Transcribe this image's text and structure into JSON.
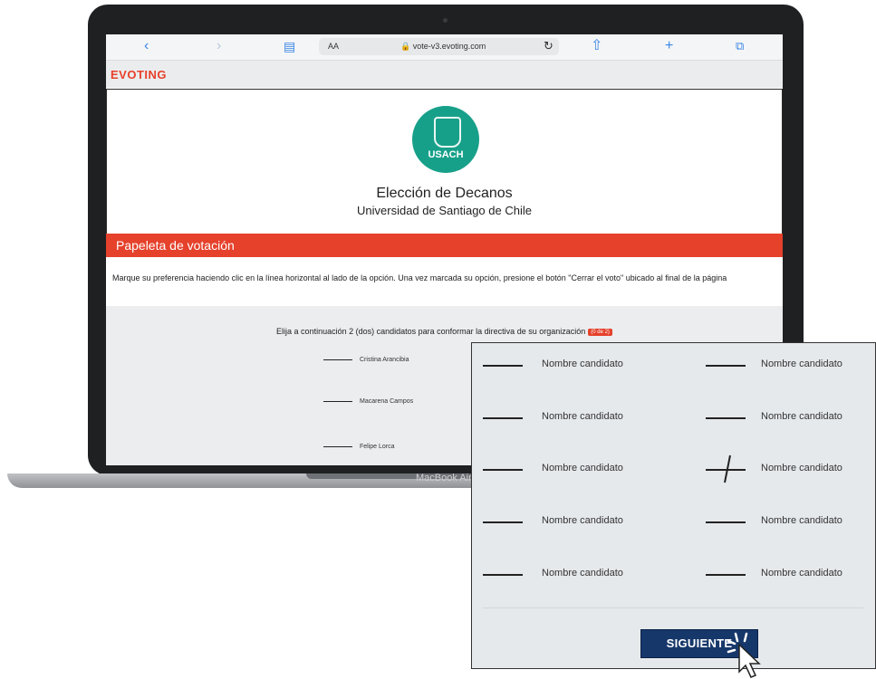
{
  "browser": {
    "url": "vote-v3.evoting.com",
    "aa_label": "AA",
    "icons": [
      "chevron-left-icon",
      "chevron-right-icon",
      "book-icon",
      "lock-icon",
      "reload-icon",
      "share-icon",
      "plus-icon",
      "tabs-icon"
    ]
  },
  "site": {
    "logo": "EVOTING",
    "org_logo_text": "USACH",
    "title": "Elección de Decanos",
    "subtitle": "Universidad de Santiago de Chile",
    "ballot_header": "Papeleta de votación",
    "instructions": "Marque su preferencia haciendo clic en la línea horizontal al lado de la opción. Una vez marcada su opción, presione el botón \"Cerrar el voto\" ubicado al final de la página",
    "choose_text": "Elija a continuación 2 (dos) candidatos para conformar la directiva de su organización",
    "choose_badge": "(0 de 2)",
    "candidates": [
      "Cristina Arancibia",
      "Macarena Campos",
      "Felipe Lorca"
    ]
  },
  "laptop": {
    "model": "MacBook Air"
  },
  "zoom_panel": {
    "options": [
      {
        "label": "Nombre candidato",
        "checked": false
      },
      {
        "label": "Nombre candidato",
        "checked": false
      },
      {
        "label": "Nombre candidato",
        "checked": false
      },
      {
        "label": "Nombre candidato",
        "checked": false
      },
      {
        "label": "Nombre candidato",
        "checked": false
      },
      {
        "label": "Nombre candidato",
        "checked": true
      },
      {
        "label": "Nombre candidato",
        "checked": false
      },
      {
        "label": "Nombre candidato",
        "checked": false
      },
      {
        "label": "Nombre candidato",
        "checked": false
      },
      {
        "label": "Nombre candidato",
        "checked": false
      }
    ],
    "next_label": "SIGUIENTE"
  },
  "colors": {
    "accent": "#e5412b",
    "button": "#16376a",
    "usach_green": "#17a089"
  }
}
